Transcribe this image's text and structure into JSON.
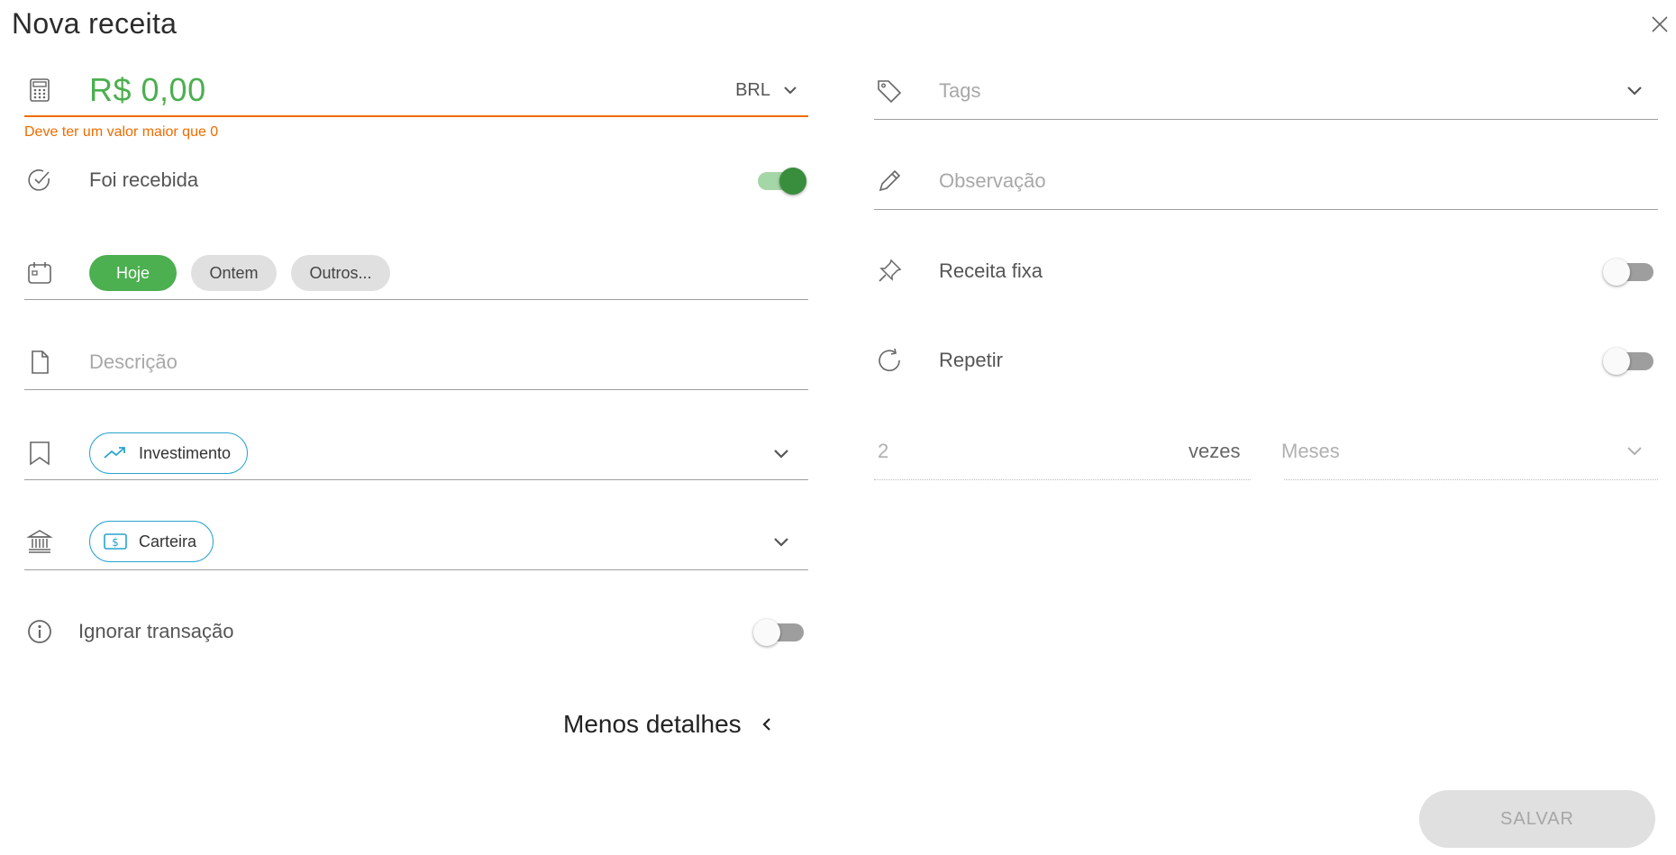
{
  "dialog": {
    "title": "Nova receita"
  },
  "amount": {
    "value": "R$ 0,00",
    "currency": "BRL",
    "error": "Deve ter um valor maior que 0"
  },
  "received": {
    "label": "Foi recebida",
    "on": true
  },
  "date": {
    "options": [
      "Hoje",
      "Ontem",
      "Outros..."
    ],
    "selected": "Hoje"
  },
  "description": {
    "placeholder": "Descrição"
  },
  "category": {
    "value": "Investimento"
  },
  "account": {
    "value": "Carteira"
  },
  "ignore": {
    "label": "Ignorar transação",
    "on": false
  },
  "toggle_details": {
    "label": "Menos detalhes"
  },
  "tags": {
    "placeholder": "Tags"
  },
  "observation": {
    "placeholder": "Observação"
  },
  "fixed": {
    "label": "Receita fixa",
    "on": false
  },
  "repeat": {
    "label": "Repetir",
    "on": false,
    "count": "2",
    "count_suffix": "vezes",
    "period_placeholder": "Meses"
  },
  "actions": {
    "save_label": "SALVAR"
  },
  "colors": {
    "accent": "#4caf50",
    "error": "#ef6c00",
    "chip_border": "#29a3cf"
  }
}
